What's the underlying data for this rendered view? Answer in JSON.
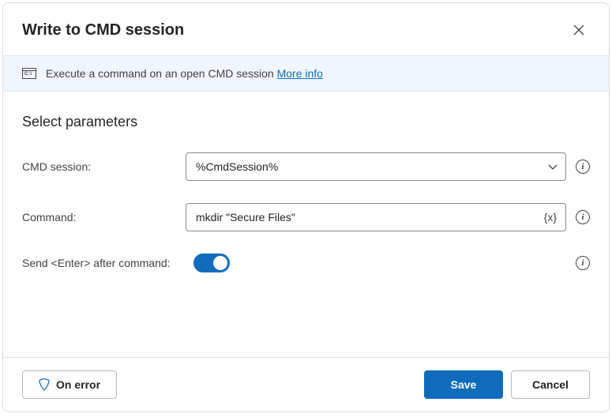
{
  "dialog": {
    "title": "Write to CMD session",
    "banner_text": "Execute a command on an open CMD session",
    "more_info": "More info"
  },
  "section": {
    "title": "Select parameters"
  },
  "params": {
    "cmd_session_label": "CMD session:",
    "cmd_session_value": "%CmdSession%",
    "command_label": "Command:",
    "command_value": "mkdir \"Secure Files\"",
    "send_enter_label": "Send <Enter> after command:",
    "send_enter_value": true
  },
  "footer": {
    "on_error": "On error",
    "save": "Save",
    "cancel": "Cancel"
  },
  "colors": {
    "primary": "#0f6cbd",
    "banner_bg": "#f0f5ff"
  }
}
